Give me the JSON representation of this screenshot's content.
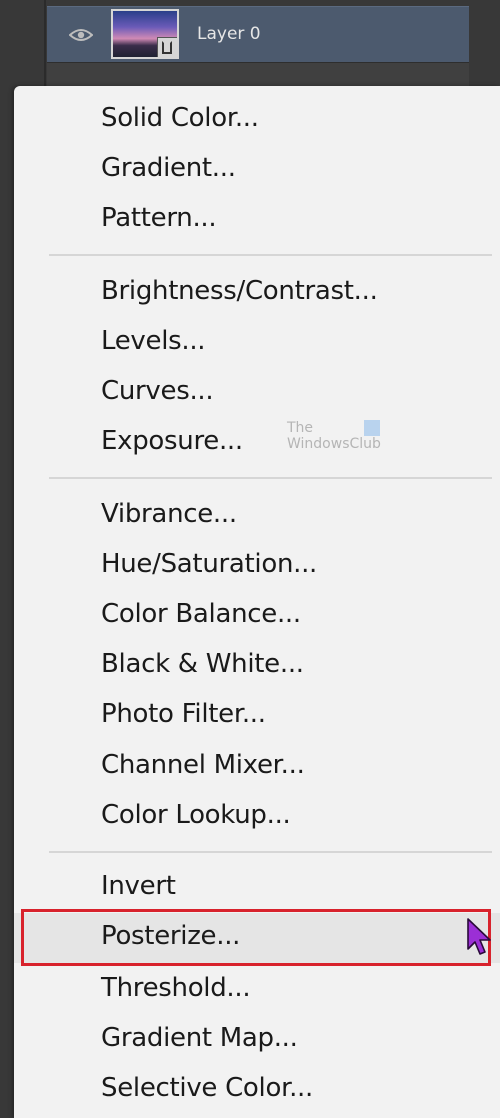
{
  "layers_panel": {
    "layer_name": "Layer 0",
    "colors": {
      "selected_row": "#4c5a6e",
      "panel": "#383838"
    }
  },
  "menu": {
    "groups": [
      [
        "Solid Color...",
        "Gradient...",
        "Pattern..."
      ],
      [
        "Brightness/Contrast...",
        "Levels...",
        "Curves...",
        "Exposure..."
      ],
      [
        "Vibrance...",
        "Hue/Saturation...",
        "Color Balance...",
        "Black & White...",
        "Photo Filter...",
        "Channel Mixer...",
        "Color Lookup..."
      ],
      [
        "Invert",
        "Posterize...",
        "Threshold...",
        "Gradient Map...",
        "Selective Color..."
      ]
    ],
    "highlighted_item": "Posterize...",
    "highlight_color": "#d8222c"
  },
  "watermark": {
    "line1": "The",
    "line2": "WindowsClub"
  },
  "cursor": {
    "icon": "mouse-pointer-icon",
    "color": "#9b2fd6"
  }
}
